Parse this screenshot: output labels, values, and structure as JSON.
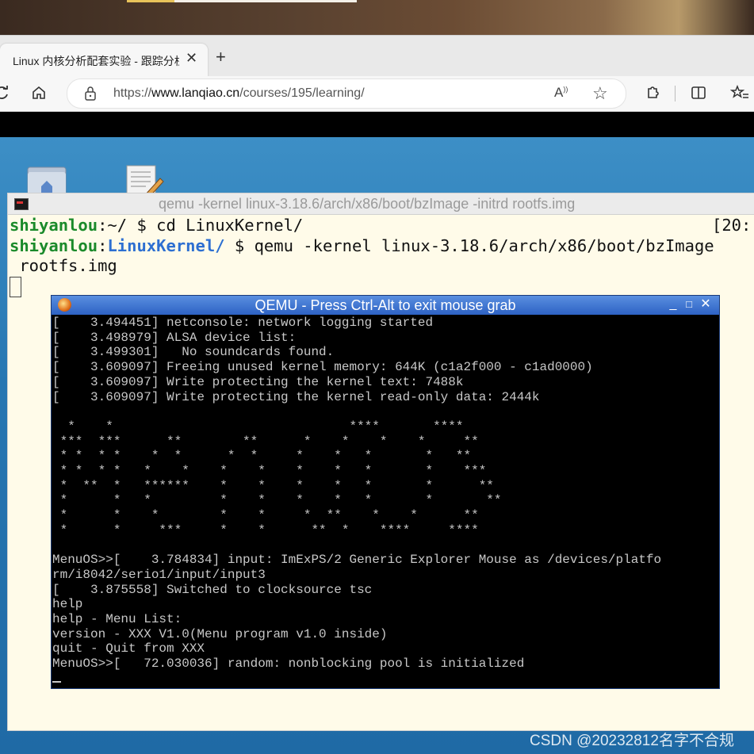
{
  "browser": {
    "tab_title": "Linux 内核分析配套实验 - 跟踪分析",
    "tab_close": "✕",
    "new_tab": "+",
    "url_prefix": "https://",
    "url_host": "www.lanqiao.cn",
    "url_path": "/courses/195/learning/"
  },
  "terminal": {
    "title": "qemu -kernel linux-3.18.6/arch/x86/boot/bzImage -initrd rootfs.img",
    "line1_user": "shiyanlou",
    "line1_rest": ":~/ $ cd LinuxKernel/",
    "line2_user": "shiyanlou",
    "line2_sep": ":",
    "line2_dir": "LinuxKernel/",
    "line2_rest": " $ qemu -kernel linux-3.18.6/arch/x86/boot/bzImage",
    "line3": " rootfs.img",
    "time_fragment": "[20:"
  },
  "qemu": {
    "title": "QEMU - Press Ctrl-Alt to exit mouse grab",
    "min": "_",
    "max": "□",
    "close": "✕",
    "console": "[    3.494451] netconsole: network logging started\n[    3.498979] ALSA device list:\n[    3.499301]   No soundcards found.\n[    3.609097] Freeing unused kernel memory: 644K (c1a2f000 - c1ad0000)\n[    3.609097] Write protecting the kernel text: 7488k\n[    3.609097] Write protecting the kernel read-only data: 2444k\n\n  *    *                               ****       ****\n ***  ***      **        **      *    *    *    *     **\n * *  * *    *  *      *  *     *    *   *       *   **\n * *  * *   *    *    *    *    *    *   *       *    ***\n *  **  *   ******    *    *    *    *   *       *      **\n *      *   *         *    *    *    *   *       *       **\n *      *    *        *    *     *  **    *    *      **\n *      *     ***     *    *      **  *    ****     ****\n\nMenuOS>>[    3.784834] input: ImExPS/2 Generic Explorer Mouse as /devices/platfo\nrm/i8042/serio1/input/input3\n[    3.875558] Switched to clocksource tsc\nhelp\nhelp - Menu List:\nversion - XXX V1.0(Menu program v1.0 inside)\nquit - Quit from XXX\nMenuOS>>[   72.030036] random: nonblocking pool is initialized"
  },
  "watermark": "CSDN @20232812名字不合规",
  "icons": [
    "back-icon",
    "home-icon",
    "lock-icon",
    "read-aloud-icon",
    "favorite-star-icon",
    "extensions-icon",
    "split-screen-icon",
    "favorites-icon"
  ]
}
